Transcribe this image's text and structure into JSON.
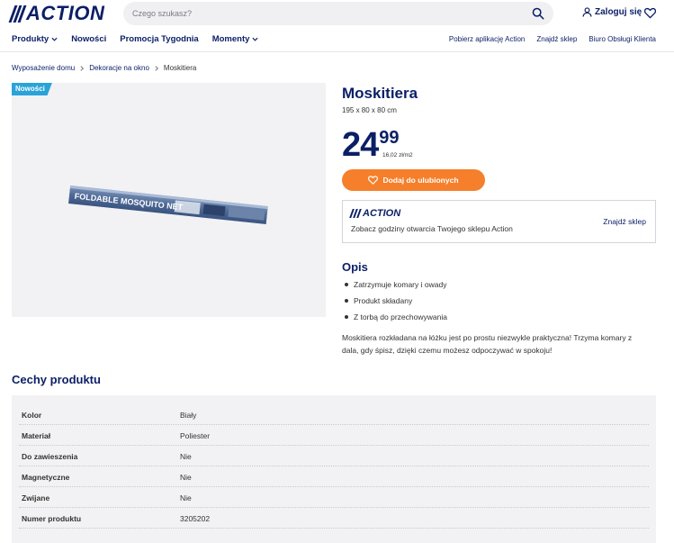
{
  "header": {
    "logo_text": "ACTION",
    "search": {
      "placeholder": "Czego szukasz?"
    },
    "login_label": "Zaloguj się"
  },
  "nav": {
    "left": [
      "Produkty",
      "Nowości",
      "Promocja Tygodnia",
      "Momenty"
    ],
    "right": [
      "Pobierz aplikację Action",
      "Znajdź sklep",
      "Biuro Obsługi Klienta"
    ]
  },
  "breadcrumb": {
    "items": [
      "Wyposażenie domu",
      "Dekoracje na okno"
    ],
    "current": "Moskitiera"
  },
  "product": {
    "badge": "Nowości",
    "box_label": "FOLDABLE MOSQUITO NET",
    "title": "Moskitiera",
    "dimensions": "195 x 80 x 80 cm",
    "price_int": "24",
    "price_dec": "99",
    "unit_price": "16,02 zł/m2",
    "favorite_label": "Dodaj do ulubionych"
  },
  "store": {
    "logo_text": "ACTION",
    "text": "Zobacz godziny otwarcia Twojego sklepu Action",
    "link": "Znajdź sklep"
  },
  "description": {
    "title": "Opis",
    "bullets": [
      "Zatrzymuje komary i owady",
      "Produkt składany",
      "Z torbą do przechowywania"
    ],
    "text": "Moskitiera rozkładana na łóżku jest po prostu niezwykle praktyczna! Trzyma komary z dala, gdy śpisz, dzięki czemu możesz odpoczywać w spokoju!"
  },
  "features": {
    "title": "Cechy produktu",
    "rows": [
      {
        "name": "Kolor",
        "value": "Biały"
      },
      {
        "name": "Materiał",
        "value": "Poliester"
      },
      {
        "name": "Do zawieszenia",
        "value": "Nie"
      },
      {
        "name": "Magnetyczne",
        "value": "Nie"
      },
      {
        "name": "Zwijane",
        "value": "Nie"
      },
      {
        "name": "Numer produktu",
        "value": "3205202"
      }
    ]
  },
  "colors": {
    "brand_navy": "#0b1f66",
    "accent_orange": "#f57f2a",
    "badge_blue": "#2aa3d8"
  },
  "icons": [
    "search-icon",
    "user-icon",
    "heart-icon",
    "chevron-down-icon",
    "chevron-right-icon"
  ]
}
